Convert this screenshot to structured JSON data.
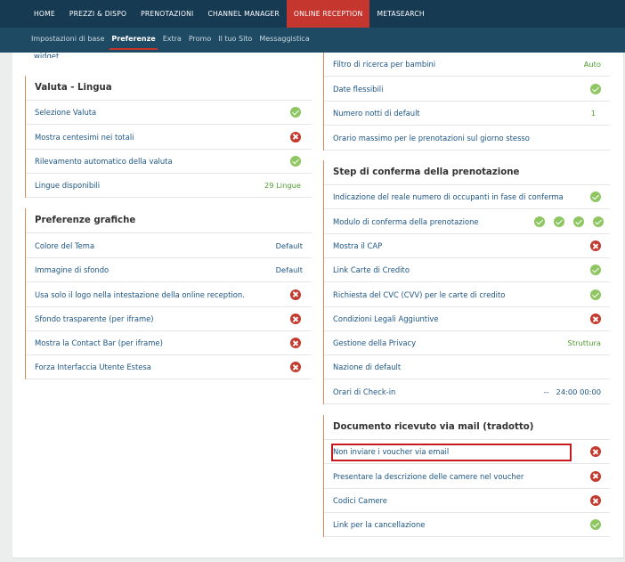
{
  "top_nav": [
    "HOME",
    "PREZZI & DISPO",
    "PRENOTAZIONI",
    "CHANNEL MANAGER",
    "ONLINE RECEPTION",
    "METASEARCH"
  ],
  "sub_nav": [
    "Impostazioni di base",
    "Preferenze",
    "Extra",
    "Promo",
    "Il tuo Sito",
    "Messaggistica"
  ],
  "left": {
    "partial_label": "widget",
    "valuta": {
      "title": "Valuta - Lingua",
      "rows": [
        {
          "label": "Selezione Valuta",
          "value": "ok"
        },
        {
          "label": "Mostra centesimi nei totali",
          "value": "ko"
        },
        {
          "label": "Rilevamento automatico della valuta",
          "value": "ok"
        },
        {
          "label": "Lingue disponibili",
          "value": "29 Lingue"
        }
      ]
    },
    "grafiche": {
      "title": "Preferenze grafiche",
      "rows": [
        {
          "label": "Colore del Tema",
          "value": "Default"
        },
        {
          "label": "Immagine di sfondo",
          "value": "Default"
        },
        {
          "label": "Usa solo il logo nella intestazione della online reception.",
          "value": "ko"
        },
        {
          "label": "Sfondo trasparente (per iframe)",
          "value": "ko"
        },
        {
          "label": "Mostra la Contact Bar (per iframe)",
          "value": "ko"
        },
        {
          "label": "Forza Interfaccia Utente Estesa",
          "value": "ko"
        }
      ]
    }
  },
  "right": {
    "top_rows": [
      {
        "label": "Filtro di ricerca per bambini",
        "value": "Auto"
      },
      {
        "label": "Date flessibili",
        "value": "ok"
      },
      {
        "label": "Numero notti di default",
        "value": "1"
      },
      {
        "label": "Orario massimo per le prenotazioni sul giorno stesso",
        "value": ""
      }
    ],
    "step": {
      "title": "Step di conferma della prenotazione",
      "rows": [
        {
          "label": "Indicazione del reale numero di occupanti in fase di conferma",
          "value": "ok"
        },
        {
          "label": "Modulo di conferma della prenotazione",
          "value": "ok4"
        },
        {
          "label": "Mostra il CAP",
          "value": "ko"
        },
        {
          "label": "Link Carte di Credito",
          "value": "ok"
        },
        {
          "label": "Richiesta del CVC (CVV) per le carte di credito",
          "value": "ok"
        },
        {
          "label": "Condizioni Legali Aggiuntive",
          "value": "ko"
        },
        {
          "label": "Gestione della Privacy",
          "value": "Struttura"
        },
        {
          "label": "Nazione di default",
          "value": ""
        },
        {
          "label": "Orari di Check-in",
          "value": "--   24:00 00:00"
        }
      ]
    },
    "documento": {
      "title": "Documento ricevuto via mail (tradotto)",
      "rows": [
        {
          "label": "Non inviare i voucher via email",
          "value": "ko"
        },
        {
          "label": "Presentare la descrizione delle camere nel voucher",
          "value": "ko"
        },
        {
          "label": "Codici Camere",
          "value": "ko"
        },
        {
          "label": "Link per la cancellazione",
          "value": "ok"
        }
      ]
    }
  },
  "colors": {
    "nav_bg": "#173a53",
    "subnav_bg": "#1f4a63",
    "accent": "#c5362f",
    "link": "#1c5584",
    "value_green": "#4f9d2e",
    "ok_icon": "#8ec662",
    "ko_icon": "#c43a2f"
  }
}
